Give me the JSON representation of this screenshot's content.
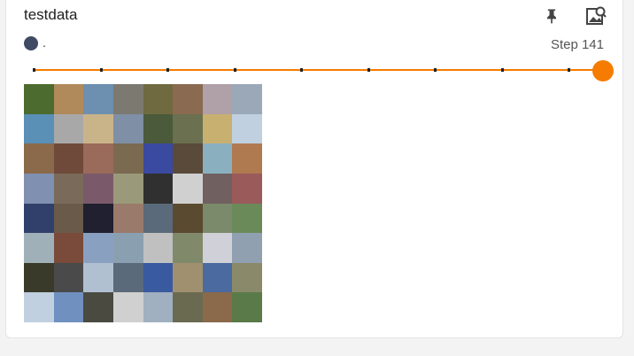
{
  "card": {
    "title": "testdata"
  },
  "run": {
    "label": ".",
    "color": "#3f4a63"
  },
  "step": {
    "label": "Step 141",
    "current": 141,
    "fraction": 1.0
  },
  "slider": {
    "tick_count": 9,
    "accent": "#f57c00"
  },
  "icons": {
    "pin": "pin-icon",
    "expand": "image-search-icon"
  },
  "image_grid": {
    "rows": 8,
    "cols": 8,
    "tile_colors": [
      "#4c6b2e",
      "#b08a5a",
      "#6d8fb0",
      "#7c7a70",
      "#6f6a3f",
      "#8a6a50",
      "#b0a0a8",
      "#9aa8b8",
      "#5a8fb6",
      "#a8a8a8",
      "#c9b48a",
      "#7f8fa6",
      "#4a5a3a",
      "#6a7050",
      "#c8b070",
      "#c0d0e0",
      "#8a6a4a",
      "#6f4a3a",
      "#9a6a5a",
      "#7a6a50",
      "#3a4aa0",
      "#5a4a3a",
      "#8ab0c0",
      "#b07a50",
      "#8090b0",
      "#7a6a5a",
      "#7a5a6a",
      "#9a9a7a",
      "#303030",
      "#d0d0d0",
      "#706060",
      "#9a5a5a",
      "#30406a",
      "#6a5a4a",
      "#202030",
      "#9a7a6a",
      "#5a6a7a",
      "#5a4a30",
      "#7a8a6a",
      "#6a8a5a",
      "#a0b0b8",
      "#7a4a3a",
      "#8aa0c0",
      "#8aa0b0",
      "#c0c0c0",
      "#808a6a",
      "#d0d0d8",
      "#90a0b0",
      "#3a3a2a",
      "#4a4a4a",
      "#b0c0d0",
      "#5a6a7a",
      "#3a5aa0",
      "#a09070",
      "#4a6aa0",
      "#8a8a6a",
      "#c0d0e0",
      "#7090c0",
      "#4a4a40",
      "#d0d0d0",
      "#a0b0c0",
      "#6a6a50",
      "#8a6a4a",
      "#5a7a4a"
    ]
  }
}
